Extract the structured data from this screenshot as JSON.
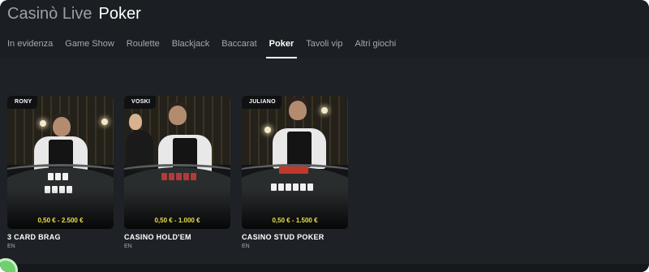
{
  "header": {
    "breadcrumb": "Casinò Live",
    "title": "Poker"
  },
  "tabs": [
    {
      "label": "In evidenza",
      "active": false
    },
    {
      "label": "Game Show",
      "active": false
    },
    {
      "label": "Roulette",
      "active": false
    },
    {
      "label": "Blackjack",
      "active": false
    },
    {
      "label": "Baccarat",
      "active": false
    },
    {
      "label": "Poker",
      "active": true
    },
    {
      "label": "Tavoli vip",
      "active": false
    },
    {
      "label": "Altri giochi",
      "active": false
    }
  ],
  "games": [
    {
      "dealer": "RONY",
      "limits": "0,50 € - 2.500 €",
      "title": "3 CARD BRAG",
      "language": "EN"
    },
    {
      "dealer": "VOSKI",
      "limits": "0,50 € - 1.000 €",
      "title": "CASINO HOLD'EM",
      "language": "EN"
    },
    {
      "dealer": "JULIANO",
      "limits": "0,50 € - 1.500 €",
      "title": "CASINO STUD POKER",
      "language": "EN"
    }
  ],
  "colors": {
    "background": "#1e2226",
    "header": "#1b1f23",
    "tab_inactive": "#a3a9ae",
    "tab_active": "#ffffff",
    "limits": "#e6e04a",
    "chat_bubble": "#6fd06f"
  },
  "icons": {
    "chat": "chat-bubble-icon"
  }
}
